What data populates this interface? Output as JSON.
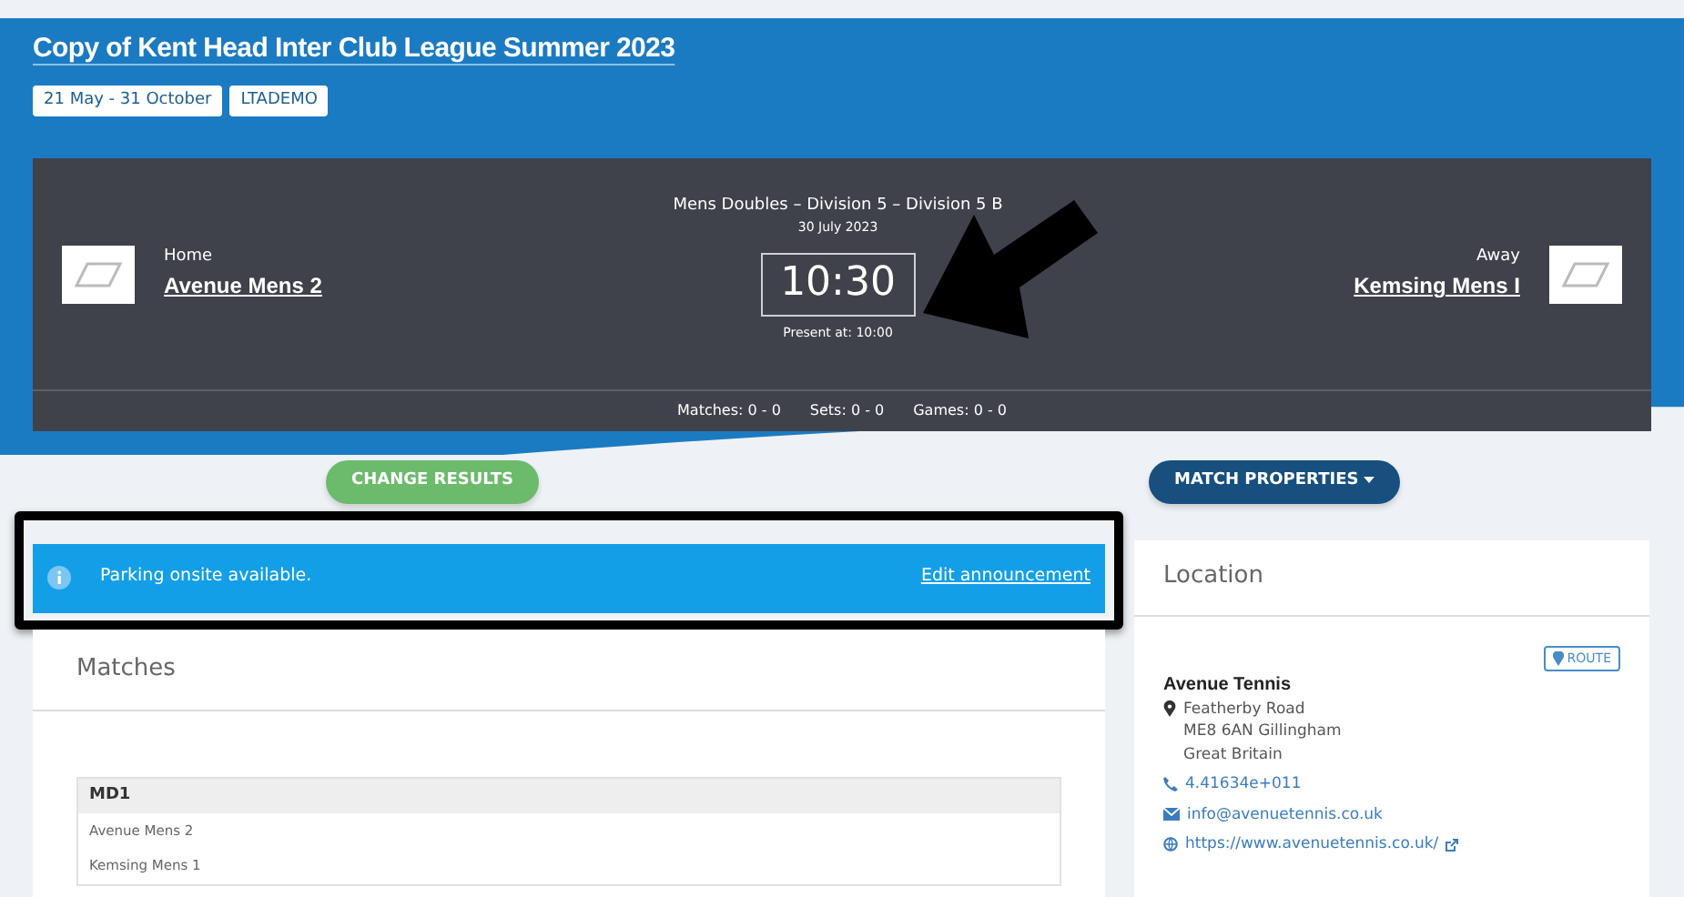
{
  "header": {
    "title": "Copy of Kent Head Inter Club League Summer 2023",
    "tags": [
      "21 May - 31 October",
      "LTADEMO"
    ]
  },
  "fixture": {
    "division": "Mens Doubles – Division 5 – Division 5 B",
    "date": "30 July 2023",
    "time": "10:30",
    "present": "Present at: 10:00",
    "home": {
      "label": "Home",
      "team": "Avenue Mens 2"
    },
    "away": {
      "label": "Away",
      "team": "Kemsing Mens I"
    },
    "totals": [
      "Matches: 0 - 0",
      "Sets: 0 - 0",
      "Games: 0 - 0"
    ]
  },
  "actions": {
    "change_results": "CHANGE RESULTS",
    "match_properties": "MATCH PROPERTIES"
  },
  "announcement": {
    "text": "Parking onsite available.",
    "link": "Edit announcement"
  },
  "matches": {
    "title": "Matches",
    "items": [
      {
        "code": "MD1",
        "players": [
          "Avenue Mens 2",
          "Kemsing Mens 1"
        ]
      }
    ]
  },
  "location": {
    "title": "Location",
    "route": "ROUTE",
    "venue": "Avenue Tennis",
    "address": [
      "Featherby Road",
      "ME8 6AN Gillingham",
      "Great Britain"
    ],
    "phone": "4.41634e+011",
    "email": "info@avenuetennis.co.uk",
    "website": "https://www.avenuetennis.co.uk/"
  }
}
